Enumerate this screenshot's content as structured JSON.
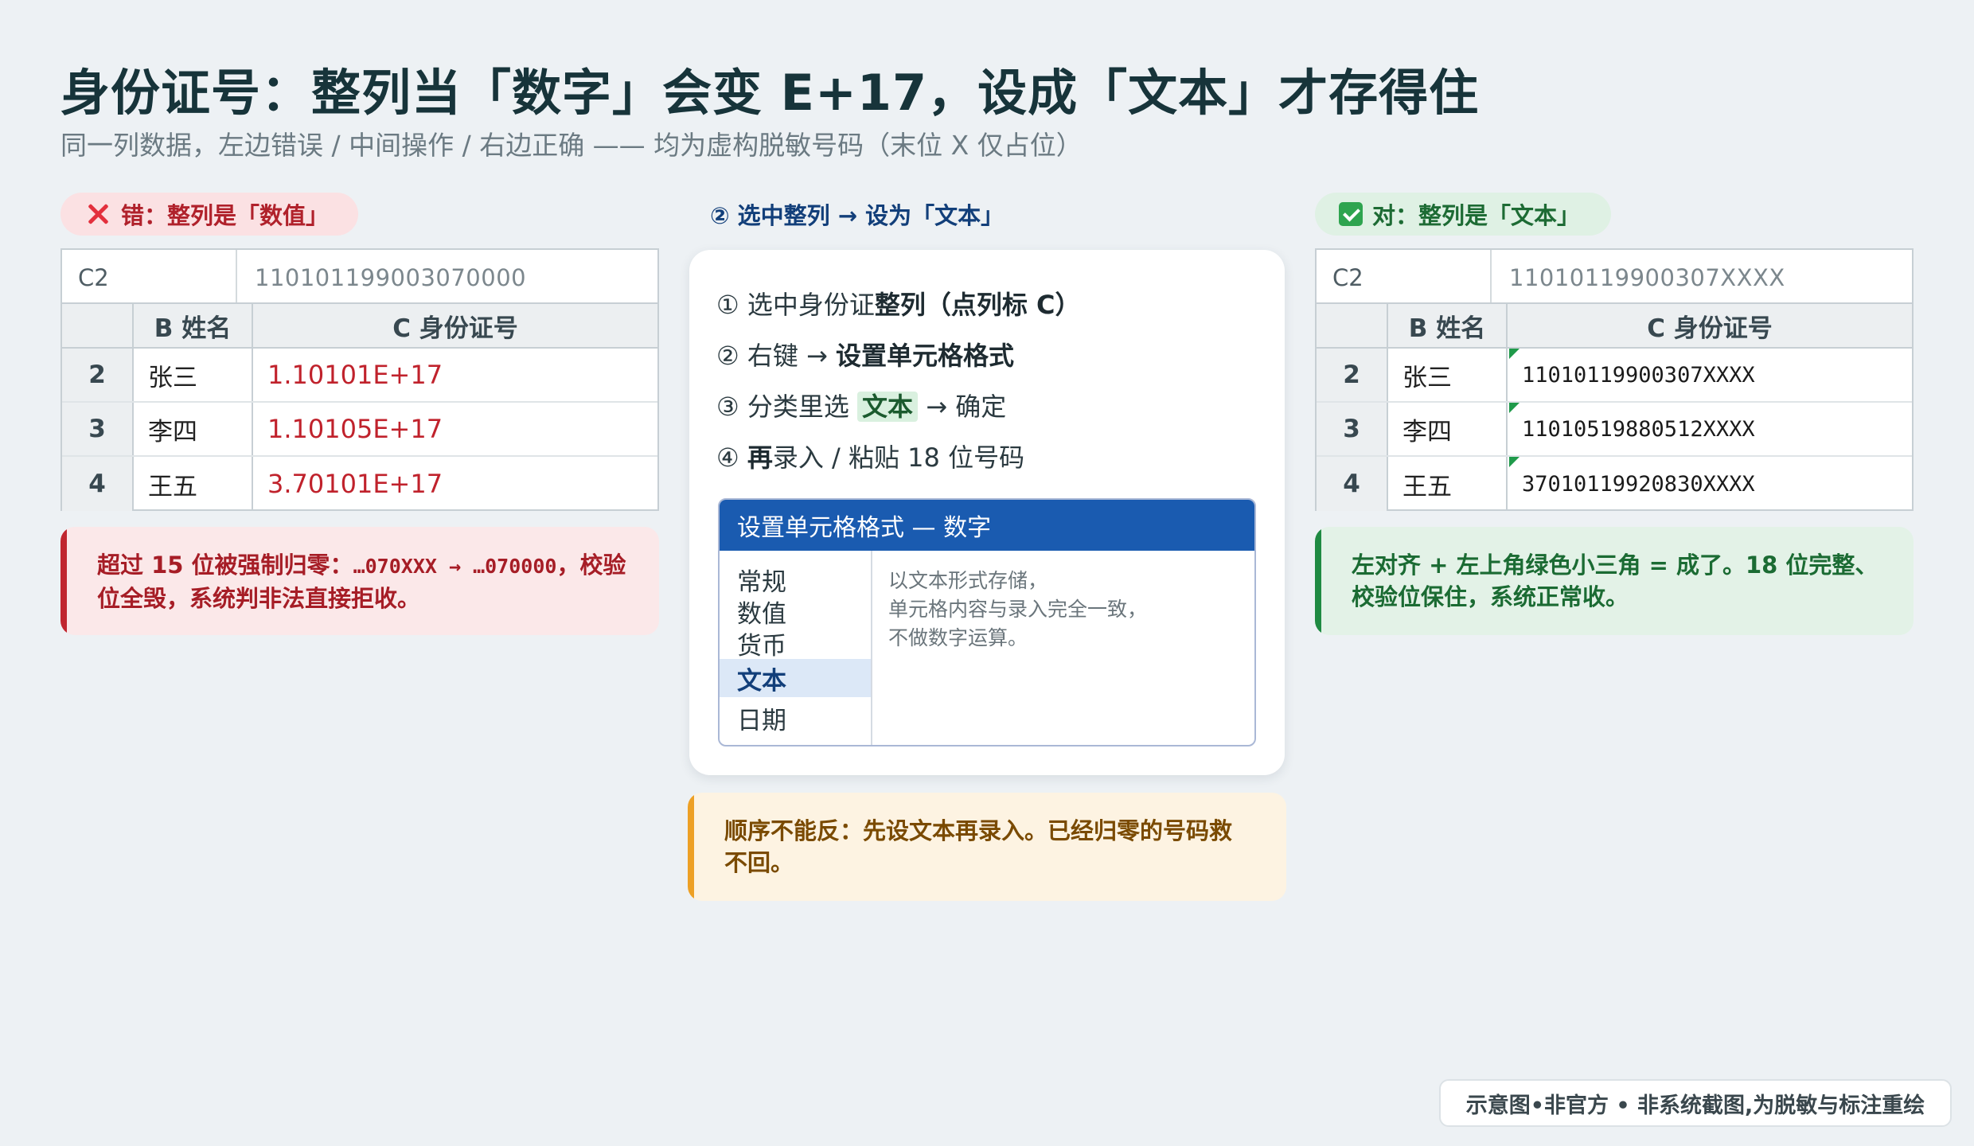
{
  "title": "身份证号：整列当「数字」会变 E+17，设成「文本」才存得住",
  "subtitle": "同一列数据，左边错误 / 中间操作 / 右边正确 —— 均为虚构脱敏号码（末位 X 仅占位）",
  "left": {
    "label": "错：整列是「数值」",
    "icon": "cross-icon",
    "accent": "#c0262f",
    "formula_ref": "C2",
    "formula_value": "110101199003070000",
    "col_b_header": "B 姓名",
    "col_c_header": "C 身份证号",
    "rows": [
      {
        "index": "2",
        "name": "张三",
        "value": "1.10101E+17"
      },
      {
        "index": "3",
        "name": "李四",
        "value": "1.10105E+17"
      },
      {
        "index": "4",
        "name": "王五",
        "value": "3.70101E+17"
      }
    ],
    "note_prefix": "超过 15 位被强制归零：",
    "note_code": "…070XXX → …070000",
    "note_suffix": "，校验位全毁，系统判非法直接拒收。"
  },
  "middle": {
    "label": "② 选中整列 → 设为「文本」",
    "steps": {
      "s1_a": "① 选中身份证",
      "s1_b": "整列",
      "s1_c": "（点列标 C）",
      "s2_a": "② 右键 → ",
      "s2_b": "设置单元格格式",
      "s3_a": "③ 分类里选 ",
      "s3_b": "文本",
      "s3_c": " → 确定",
      "s4_a": "④ ",
      "s4_b": "再",
      "s4_c": "录入 / 粘贴 18 位号码"
    },
    "dialog": {
      "title": "设置单元格格式 — 数字",
      "categories": [
        "常规",
        "数值",
        "货币",
        "文本",
        "日期"
      ],
      "selected": "文本",
      "desc_lines": [
        "以文本形式存储，",
        "单元格内容与录入完全一致，",
        "不做数字运算。"
      ]
    },
    "note": "顺序不能反：先设文本再录入。已经归零的号码救不回。",
    "accent": "#eda025"
  },
  "right": {
    "label": "对：整列是「文本」",
    "icon": "check-icon",
    "accent": "#1f8a42",
    "formula_ref": "C2",
    "formula_value": "11010119900307XXXX",
    "col_b_header": "B 姓名",
    "col_c_header": "C 身份证号",
    "rows": [
      {
        "index": "2",
        "name": "张三",
        "value": "11010119900307XXXX"
      },
      {
        "index": "3",
        "name": "李四",
        "value": "11010519880512XXXX"
      },
      {
        "index": "4",
        "name": "王五",
        "value": "37010119920830XXXX"
      }
    ],
    "note": "左对齐 + 左上角绿色小三角 = 成了。18 位完整、校验位保住，系统正常收。"
  },
  "footer": "示意图•非官方 • 非系统截图,为脱敏与标注重绘"
}
